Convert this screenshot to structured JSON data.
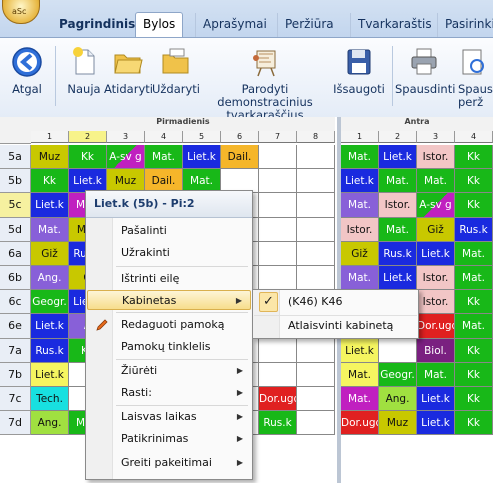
{
  "app_icon_text": "aSc",
  "tabs": [
    "Pagrindinis",
    "Bylos",
    "Aprašymai",
    "Peržiūra",
    "Tvarkaraštis",
    "Pasirinkim"
  ],
  "active_tab": "Bylos",
  "ribbon": {
    "back": "Atgal",
    "new": "Nauja",
    "open": "Atidaryti",
    "close": "Uždaryti",
    "demo": "Parodyti demonstracinius tvarkaraščius",
    "save": "Išsaugoti",
    "print": "Spausdinti",
    "print2": "Spausd perž"
  },
  "day_headers": [
    "Pirmadienis",
    "Antra"
  ],
  "period_numbers": [
    "1",
    "2",
    "3",
    "4",
    "5",
    "6",
    "7",
    "8"
  ],
  "period_numbers_day2": [
    "1",
    "2",
    "3",
    "4",
    "5"
  ],
  "rows": [
    "5a",
    "5b",
    "5c",
    "5d",
    "6a",
    "6b",
    "6c",
    "6e",
    "7a",
    "7b",
    "7c",
    "7d"
  ],
  "selected_row": "5c",
  "grid_monday": [
    [
      "Muz|#c8c800",
      "Kk|#18b818",
      "A-sv g|#18b818/#c020c0",
      "Mat.|#18b818",
      "Liet.k|#1a2adf",
      "Dail.|#f5b62a",
      "",
      ""
    ],
    [
      "Kk|#18b818",
      "Liet.k|#1a2adf",
      "Muz|#c8c800",
      "Dail.|#f5b62a",
      "Mat.|#18b818",
      "",
      "",
      ""
    ],
    [
      "Liet.k|#1a2adf",
      "Mat.|#c020c0",
      "",
      "",
      "",
      "",
      "",
      ""
    ],
    [
      "Mat.|#8860d8",
      "Muz|#c8c800",
      "",
      "",
      "",
      "",
      "",
      ""
    ],
    [
      "Giž|#c8c800",
      "Rus.k|#1a2adf",
      "",
      "",
      "",
      "",
      "",
      ""
    ],
    [
      "Ang.|#8860d8",
      "G|#c8c800",
      "",
      "",
      "",
      "",
      "",
      ""
    ],
    [
      "Geogr.|#18b818",
      "Liet.k|#1a2adf",
      "",
      "",
      "",
      "",
      "",
      ""
    ],
    [
      "Liet.k|#1a2adf",
      "A|#8860d8",
      "",
      "",
      "",
      "",
      "",
      ""
    ],
    [
      "Rus.k|#1a2adf",
      "Kk|#18b818",
      "",
      "",
      "",
      "",
      "",
      ""
    ],
    [
      "Liet.k|#f5f560",
      "Mat.|#fff",
      "",
      "",
      "",
      "",
      "",
      ""
    ],
    [
      "Tech.|#18e0e0",
      "",
      "",
      "",
      "",
      "",
      "Dor.ugd|#e02020",
      ""
    ],
    [
      "Ang.|#a0e040",
      "Mat.|#18b818",
      "",
      "",
      "",
      "",
      "Rus.k|#18b818",
      ""
    ],
    [
      "Mat.|#1a2adf",
      "Tech.|#18e0e0",
      "",
      "",
      "",
      "",
      "",
      ""
    ]
  ],
  "grid_tuesday": [
    [
      "Mat.|#18b818",
      "Liet.k|#1a2adf",
      "Istor.|#f2c6c6",
      "Kk|#18b818"
    ],
    [
      "Liet.k|#1a2adf",
      "Mat.|#18b818",
      "Mat.|#18b818",
      "Kk|#18b818"
    ],
    [
      "Mat.|#8860d8",
      "Istor.|#f2c6c6",
      "A-sv g|#18b818/#c020c0",
      "Kk|#18b818"
    ],
    [
      "Istor.|#f2c6c6",
      "Mat.|#18b818",
      "Giž|#c8c800",
      "Rus.k|#1a2adf"
    ],
    [
      "Giž|#c8c800",
      "Rus.k|#1a2adf",
      "Liet.k|#1a2adf",
      "Mat.|#18b818"
    ],
    [
      "Mat.|#8860d8",
      "Liet.k|#1a2adf",
      "Istor.|#f2c6c6",
      "Mat.|#18b818"
    ],
    [
      "Liet.k|#18b818",
      "Mat.|#fff",
      "Istor.|#f2c6c6",
      "Kk|#18b818"
    ],
    [
      "Ang.|#a83030",
      "Istor.|#18b818",
      "Dor.ugd|#e02020",
      "Mat.|#18b818"
    ],
    [
      "Liet.k|#f5f560",
      "Mat.|#fff",
      "Biol.|#7a2080",
      "Kk|#18b818"
    ],
    [
      "Mat.|#f5f560",
      "Geogr.|#18b818",
      "Mat.|#18b818",
      "Kk|#18b818"
    ],
    [
      "Mat.|#c020c0",
      "Ang.|#a0e040",
      "Liet.k|#1a2adf",
      "Kk|#18b818"
    ],
    [
      "Dor.ugd|#e02020",
      "Muz|#c8c800",
      "Liet.k|#1a2adf",
      "Kk|#18b818"
    ]
  ],
  "menu": {
    "header": "Liet.k (5b) - Pi:2",
    "items": {
      "remove": "Pašalinti",
      "lock": "Užrakinti",
      "delete_row": "Ištrinti eilę",
      "rooms": "Kabinetas",
      "edit": "Redaguoti pamoką",
      "lesson_grid": "Pamokų tinklelis",
      "view": "Žiūrėti",
      "find": "Rasti:",
      "free_time": "Laisvas laikas",
      "check": "Patikrinimas",
      "quick_change": "Greiti pakeitimai"
    }
  },
  "submenu": {
    "room": "(K46) K46",
    "free_room": "Atlaisvinti kabinetą",
    "checked": "✓"
  }
}
